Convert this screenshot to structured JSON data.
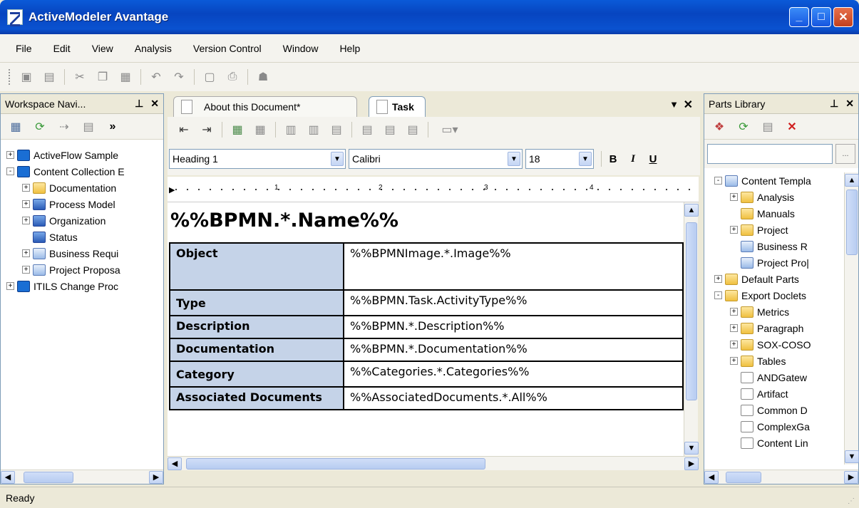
{
  "window": {
    "title": "ActiveModeler Avantage"
  },
  "menu": [
    "File",
    "Edit",
    "View",
    "Analysis",
    "Version Control",
    "Window",
    "Help"
  ],
  "workspace": {
    "title": "Workspace Navi...",
    "tree": [
      {
        "label": "ActiveFlow Sample",
        "level": 0,
        "icon": "process-icon",
        "expander": "+"
      },
      {
        "label": "Content Collection E",
        "level": 0,
        "icon": "process-icon",
        "expander": "-"
      },
      {
        "label": "Documentation",
        "level": 1,
        "icon": "folder-icon",
        "expander": "+"
      },
      {
        "label": "Process Model",
        "level": 1,
        "icon": "model-icon",
        "expander": "+"
      },
      {
        "label": "Organization",
        "level": 1,
        "icon": "org-icon",
        "expander": "+"
      },
      {
        "label": "Status",
        "level": 1,
        "icon": "org-icon",
        "expander": ""
      },
      {
        "label": "Business Requi",
        "level": 1,
        "icon": "doc-icon",
        "expander": "+"
      },
      {
        "label": "Project Proposa",
        "level": 1,
        "icon": "doc-icon",
        "expander": "+"
      },
      {
        "label": "ITILS Change Proc",
        "level": 0,
        "icon": "process-icon",
        "expander": "+"
      }
    ]
  },
  "editor": {
    "tabs": [
      "About this Document*",
      "Task"
    ],
    "style_combo": "Heading 1",
    "font_combo": "Calibri",
    "size_combo": "18",
    "bold": "B",
    "italic": "I",
    "underline": "U",
    "ruler_marks": [
      "1",
      "2",
      "3",
      "4"
    ],
    "heading": "%%BPMN.*.Name%%",
    "rows": [
      {
        "key": "Object",
        "value": "%%BPMNImage.*.Image%%"
      },
      {
        "key": "Type",
        "value": "%%BPMN.Task.ActivityType%%"
      },
      {
        "key": "Description",
        "value": "%%BPMN.*.Description%%"
      },
      {
        "key": "Documentation",
        "value": "%%BPMN.*.Documentation%%"
      },
      {
        "key": "Category",
        "value": "%%Categories.*.Categories%%"
      },
      {
        "key": "Associated Documents",
        "value": "%%AssociatedDocuments.*.All%%"
      }
    ]
  },
  "parts": {
    "title": "Parts Library",
    "search_button": "...",
    "tree": [
      {
        "label": "Content Templa",
        "level": 0,
        "icon": "doc-icon",
        "expander": "-"
      },
      {
        "label": "Analysis",
        "level": 1,
        "icon": "folder-icon",
        "expander": "+"
      },
      {
        "label": "Manuals",
        "level": 1,
        "icon": "folder-icon",
        "expander": ""
      },
      {
        "label": "Project",
        "level": 1,
        "icon": "folder-icon",
        "expander": "+"
      },
      {
        "label": "Business R",
        "level": 1,
        "icon": "doc-icon",
        "expander": ""
      },
      {
        "label": "Project Pro|",
        "level": 1,
        "icon": "doc-icon",
        "expander": ""
      },
      {
        "label": "Default Parts",
        "level": 0,
        "icon": "folder-icon",
        "expander": "+"
      },
      {
        "label": "Export Doclets",
        "level": 0,
        "icon": "folder-icon",
        "expander": "-"
      },
      {
        "label": "Metrics",
        "level": 1,
        "icon": "folder-icon",
        "expander": "+"
      },
      {
        "label": "Paragraph",
        "level": 1,
        "icon": "folder-icon",
        "expander": "+"
      },
      {
        "label": "SOX-COSO",
        "level": 1,
        "icon": "folder-icon",
        "expander": "+"
      },
      {
        "label": "Tables",
        "level": 1,
        "icon": "folder-icon",
        "expander": "+"
      },
      {
        "label": "ANDGatew",
        "level": 1,
        "icon": "page-icon",
        "expander": ""
      },
      {
        "label": "Artifact",
        "level": 1,
        "icon": "page-icon",
        "expander": ""
      },
      {
        "label": "Common D",
        "level": 1,
        "icon": "page-icon",
        "expander": ""
      },
      {
        "label": "ComplexGa",
        "level": 1,
        "icon": "page-icon",
        "expander": ""
      },
      {
        "label": "Content Lin",
        "level": 1,
        "icon": "page-icon",
        "expander": ""
      }
    ]
  },
  "status": {
    "text": "Ready"
  }
}
